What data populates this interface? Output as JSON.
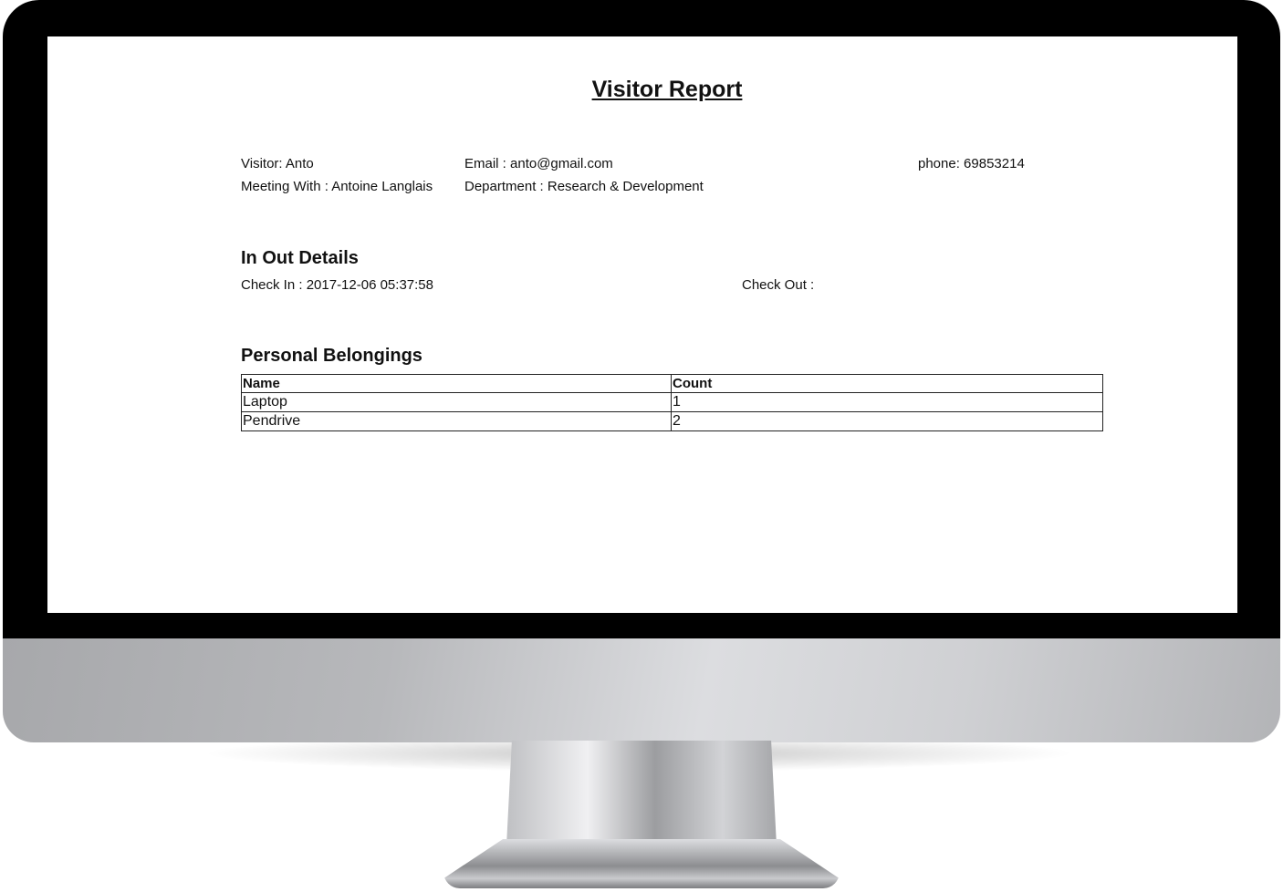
{
  "report": {
    "title": "Visitor Report",
    "visitor": "Visitor: Anto",
    "email": "Email : anto@gmail.com",
    "phone": "phone: 69853214",
    "meeting_with": "Meeting With : Antoine Langlais",
    "department": "Department : Research & Development",
    "in_out_heading": "In Out Details",
    "check_in": "Check In : 2017-12-06 05:37:58",
    "check_out": "Check Out :",
    "belongings_heading": "Personal Belongings",
    "table": {
      "headers": [
        "Name",
        "Count"
      ],
      "rows": [
        [
          "Laptop",
          "1"
        ],
        [
          "Pendrive",
          "2"
        ]
      ]
    }
  }
}
